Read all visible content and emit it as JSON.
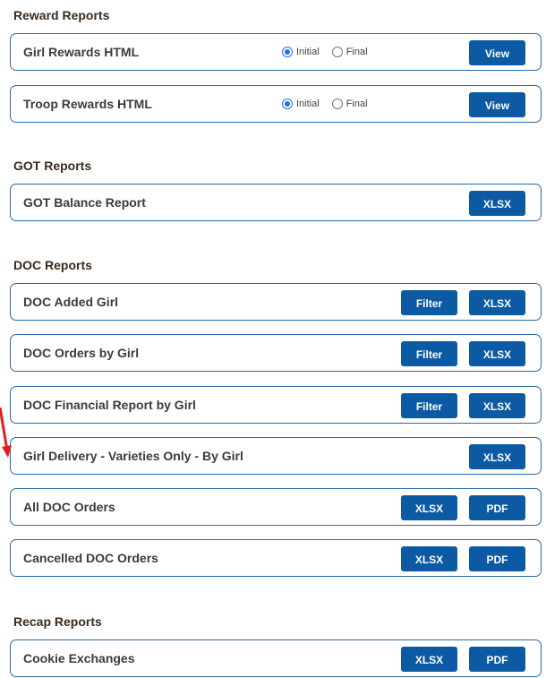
{
  "sections": {
    "reward": {
      "title": "Reward Reports",
      "rows": [
        {
          "label": "Girl Rewards HTML",
          "radio_initial": "Initial",
          "radio_final": "Final",
          "button": "View"
        },
        {
          "label": "Troop Rewards HTML",
          "radio_initial": "Initial",
          "radio_final": "Final",
          "button": "View"
        }
      ]
    },
    "got": {
      "title": "GOT Reports",
      "rows": [
        {
          "label": "GOT Balance Report",
          "button": "XLSX"
        }
      ]
    },
    "doc": {
      "title": "DOC Reports",
      "rows": [
        {
          "label": "DOC Added Girl",
          "button1": "Filter",
          "button2": "XLSX"
        },
        {
          "label": "DOC Orders by Girl",
          "button1": "Filter",
          "button2": "XLSX"
        },
        {
          "label": "DOC Financial Report by Girl",
          "button1": "Filter",
          "button2": "XLSX"
        },
        {
          "label": "Girl Delivery - Varieties Only - By Girl",
          "button": "XLSX"
        },
        {
          "label": "All DOC Orders",
          "button1": "XLSX",
          "button2": "PDF"
        },
        {
          "label": "Cancelled DOC Orders",
          "button1": "XLSX",
          "button2": "PDF"
        }
      ]
    },
    "recap": {
      "title": "Recap Reports",
      "rows": [
        {
          "label": "Cookie Exchanges",
          "button1": "XLSX",
          "button2": "PDF"
        }
      ]
    }
  },
  "colors": {
    "accent": "#0b5aa3",
    "border": "#2b6aa8",
    "annotation_arrow": "#e01e1e"
  }
}
